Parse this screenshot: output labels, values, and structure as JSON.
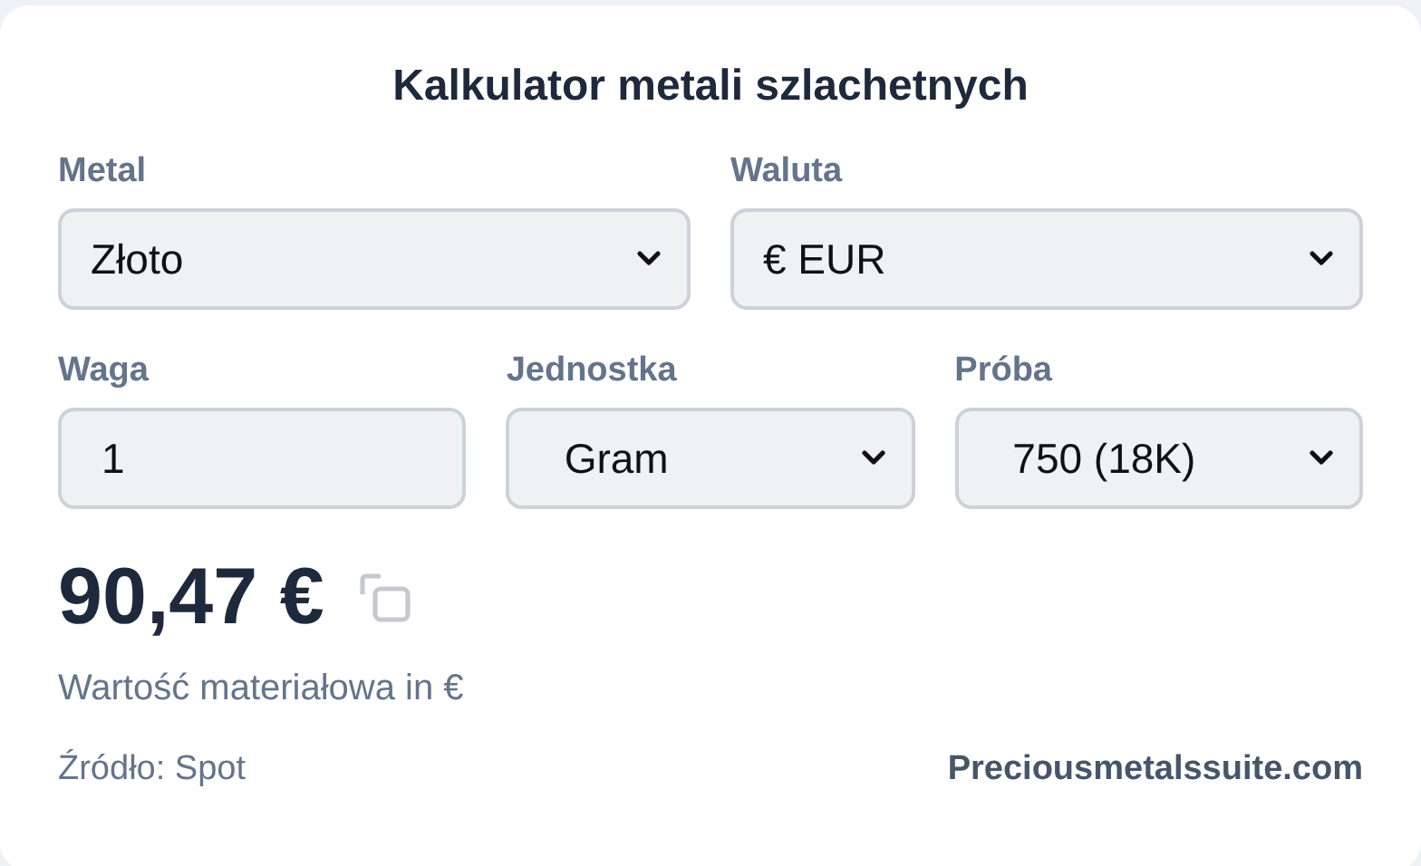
{
  "title": "Kalkulator metali szlachetnych",
  "rows": [
    [
      {
        "label": "Metal",
        "kind": "select",
        "value": "Złoto"
      },
      {
        "label": "Waluta",
        "kind": "select",
        "value": "€ EUR"
      }
    ],
    [
      {
        "label": "Waga",
        "kind": "input",
        "value": "1"
      },
      {
        "label": "Jednostka",
        "kind": "select",
        "value": "Gram"
      },
      {
        "label": "Próba",
        "kind": "select",
        "value": "750 (18K)"
      }
    ]
  ],
  "result": {
    "value": "90,47 €",
    "description": "Wartość materiałowa in €"
  },
  "footer": {
    "source": "Źródło: Spot",
    "link": "Preciousmetalssuite.com"
  }
}
